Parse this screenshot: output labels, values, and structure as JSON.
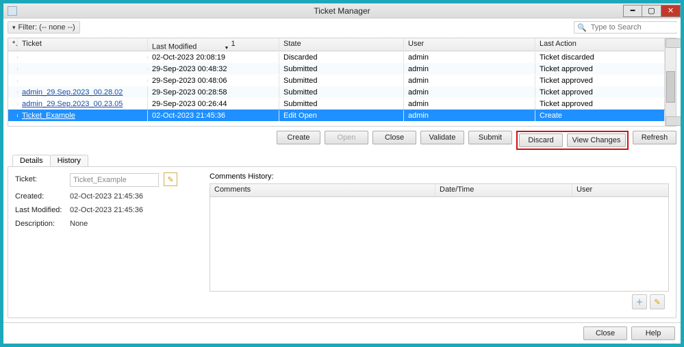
{
  "window": {
    "title": "Ticket Manager"
  },
  "filter": {
    "label": "Filter: (-- none --)"
  },
  "search": {
    "placeholder": "Type to Search"
  },
  "grid": {
    "headers": {
      "ticket": "Ticket",
      "last_modified": "Last Modified",
      "state": "State",
      "user": "User",
      "last_action": "Last Action",
      "sort_sup": "1"
    },
    "rows": [
      {
        "ticket": "",
        "modified": "02-Oct-2023 20:08:19",
        "state": "Discarded",
        "user": "admin",
        "action": "Ticket discarded",
        "link": false,
        "selected": false
      },
      {
        "ticket": "",
        "modified": "29-Sep-2023 00:48:32",
        "state": "Submitted",
        "user": "admin",
        "action": "Ticket approved",
        "link": false,
        "selected": false
      },
      {
        "ticket": "",
        "modified": "29-Sep-2023 00:48:06",
        "state": "Submitted",
        "user": "admin",
        "action": "Ticket approved",
        "link": false,
        "selected": false
      },
      {
        "ticket": "admin_29.Sep.2023_00.28.02",
        "modified": "29-Sep-2023 00:28:58",
        "state": "Submitted",
        "user": "admin",
        "action": "Ticket approved",
        "link": true,
        "selected": false
      },
      {
        "ticket": "admin_29.Sep.2023_00.23.05",
        "modified": "29-Sep-2023 00:26:44",
        "state": "Submitted",
        "user": "admin",
        "action": "Ticket approved",
        "link": true,
        "selected": false
      },
      {
        "ticket": "Ticket_Example",
        "modified": "02-Oct-2023 21:45:36",
        "state": "Edit Open",
        "user": "admin",
        "action": "Create",
        "link": true,
        "selected": true
      }
    ]
  },
  "toolbar": {
    "create": "Create",
    "open": "Open",
    "close": "Close",
    "validate": "Validate",
    "submit": "Submit",
    "discard": "Discard",
    "view_changes": "View Changes",
    "refresh": "Refresh"
  },
  "tabs": {
    "details": "Details",
    "history": "History"
  },
  "details": {
    "ticket_label": "Ticket:",
    "ticket_value": "Ticket_Example",
    "created_label": "Created:",
    "created_value": "02-Oct-2023 21:45:36",
    "modified_label": "Last Modified:",
    "modified_value": "02-Oct-2023 21:45:36",
    "description_label": "Description:",
    "description_value": "None"
  },
  "comments": {
    "title": "Comments History:",
    "headers": {
      "comments": "Comments",
      "datetime": "Date/Time",
      "user": "User"
    }
  },
  "footer": {
    "close": "Close",
    "help": "Help"
  }
}
